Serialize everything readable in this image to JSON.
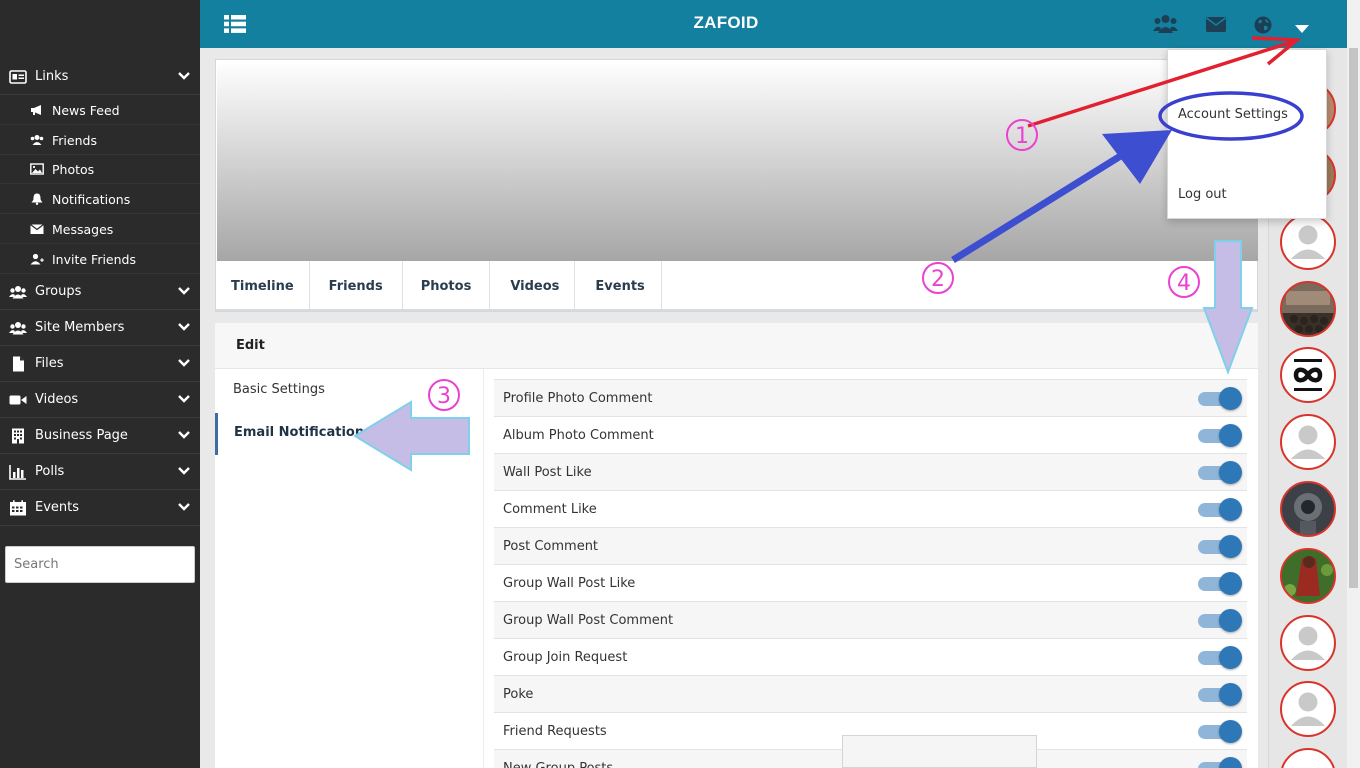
{
  "sidebar": {
    "sections": [
      {
        "label": "Links",
        "icon": "address-card-icon"
      },
      {
        "label": "Groups",
        "icon": "users-icon"
      },
      {
        "label": "Site Members",
        "icon": "users-icon"
      },
      {
        "label": "Files",
        "icon": "file-icon"
      },
      {
        "label": "Videos",
        "icon": "video-camera-icon"
      },
      {
        "label": "Business Page",
        "icon": "building-icon"
      },
      {
        "label": "Polls",
        "icon": "bar-chart-icon"
      },
      {
        "label": "Events",
        "icon": "calendar-icon"
      }
    ],
    "links": [
      {
        "label": "News Feed",
        "icon": "megaphone-icon"
      },
      {
        "label": "Friends",
        "icon": "users-icon"
      },
      {
        "label": "Photos",
        "icon": "image-icon"
      },
      {
        "label": "Notifications",
        "icon": "bell-icon"
      },
      {
        "label": "Messages",
        "icon": "envelope-icon"
      },
      {
        "label": "Invite Friends",
        "icon": "user-plus-icon"
      }
    ],
    "search_placeholder": "Search"
  },
  "topbar": {
    "brand": "ZAFOID",
    "icons": [
      "menu-grid-icon",
      "friends-icon",
      "envelope-icon",
      "globe-icon",
      "caret-down-icon"
    ]
  },
  "dropdown": {
    "account_settings": "Account Settings",
    "logout": "Log out"
  },
  "profile_tabs": [
    "Timeline",
    "Friends",
    "Photos",
    "Videos",
    "Events"
  ],
  "settings": {
    "header": "Edit",
    "menu": {
      "basic": "Basic Settings",
      "email": "Email Notifications"
    },
    "notifications": [
      {
        "label": "Profile Photo Comment",
        "enabled": true
      },
      {
        "label": "Album Photo Comment",
        "enabled": true
      },
      {
        "label": "Wall Post Like",
        "enabled": true
      },
      {
        "label": "Comment Like",
        "enabled": true
      },
      {
        "label": "Post Comment",
        "enabled": true
      },
      {
        "label": "Group Wall Post Like",
        "enabled": true
      },
      {
        "label": "Group Wall Post Comment",
        "enabled": true
      },
      {
        "label": "Group Join Request",
        "enabled": true
      },
      {
        "label": "Poke",
        "enabled": true
      },
      {
        "label": "Friend Requests",
        "enabled": true
      },
      {
        "label": "New Group Posts",
        "enabled": true
      }
    ]
  },
  "annotations": {
    "step1": "1",
    "step2": "2",
    "step3": "3",
    "step4": "4"
  },
  "colors": {
    "topbar": "#14809f",
    "sidebar": "#2b2b2b",
    "toggle_on": "#2f78b8",
    "avatar_ring": "#d9342b"
  }
}
